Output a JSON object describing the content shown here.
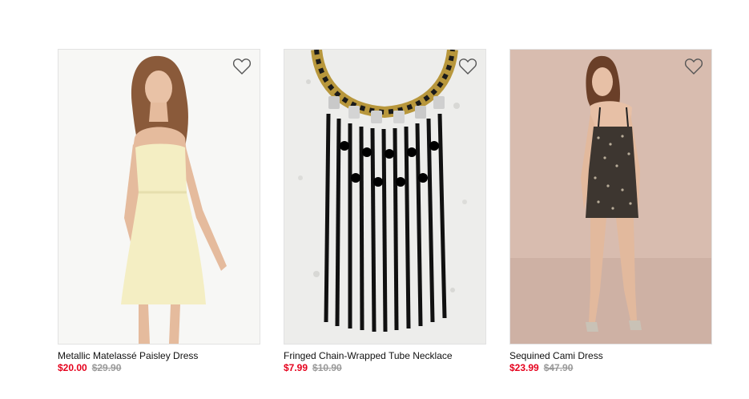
{
  "products": [
    {
      "name": "Metallic Matelassé Paisley Dress",
      "sale_price": "$20.00",
      "original_price": "$29.90",
      "image_icon": "dress-photo-icon"
    },
    {
      "name": "Fringed Chain-Wrapped Tube Necklace",
      "sale_price": "$7.99",
      "original_price": "$10.90",
      "image_icon": "necklace-photo-icon"
    },
    {
      "name": "Sequined Cami Dress",
      "sale_price": "$23.99",
      "original_price": "$47.90",
      "image_icon": "dress-photo-icon"
    }
  ],
  "colors": {
    "sale": "#e5001c",
    "original": "#9a9a9a",
    "heart_stroke": "#555555"
  }
}
